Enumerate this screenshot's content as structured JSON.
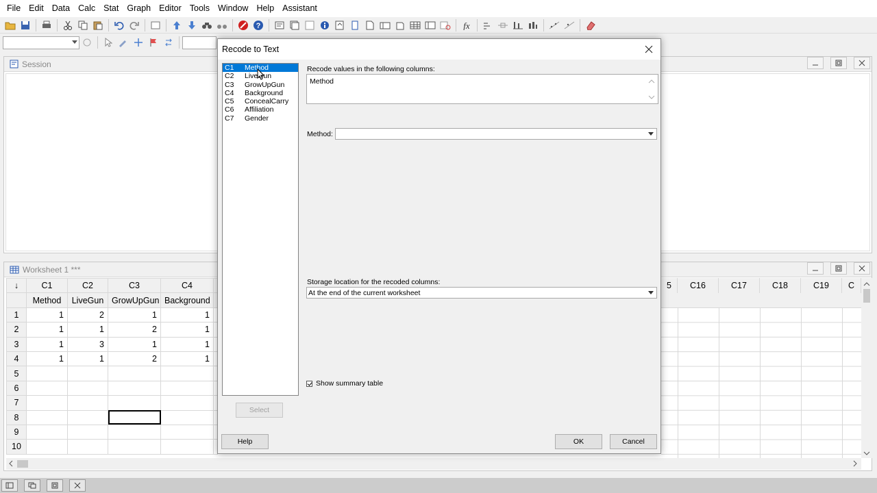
{
  "menubar": {
    "items": [
      "File",
      "Edit",
      "Data",
      "Calc",
      "Stat",
      "Graph",
      "Editor",
      "Tools",
      "Window",
      "Help",
      "Assistant"
    ]
  },
  "session": {
    "title": "Session"
  },
  "worksheet": {
    "title": "Worksheet 1 ***",
    "column_ids": [
      "C1",
      "C2",
      "C3",
      "C4"
    ],
    "column_names": [
      "Method",
      "LiveGun",
      "GrowUpGun",
      "Background"
    ],
    "right_column_ids": [
      "5",
      "C16",
      "C17",
      "C18",
      "C19",
      "C"
    ],
    "rows": [
      {
        "num": "1",
        "values": [
          "1",
          "2",
          "1",
          "1"
        ]
      },
      {
        "num": "2",
        "values": [
          "1",
          "1",
          "2",
          "1"
        ]
      },
      {
        "num": "3",
        "values": [
          "1",
          "3",
          "1",
          "1"
        ]
      },
      {
        "num": "4",
        "values": [
          "1",
          "1",
          "2",
          "1"
        ]
      },
      {
        "num": "5",
        "values": [
          "",
          "",
          "",
          ""
        ]
      },
      {
        "num": "6",
        "values": [
          "",
          "",
          "",
          ""
        ]
      },
      {
        "num": "7",
        "values": [
          "",
          "",
          "",
          ""
        ]
      },
      {
        "num": "8",
        "values": [
          "",
          "",
          "",
          ""
        ]
      },
      {
        "num": "9",
        "values": [
          "",
          "",
          "",
          ""
        ]
      },
      {
        "num": "10",
        "values": [
          "",
          "",
          "",
          ""
        ]
      }
    ]
  },
  "dialog": {
    "title": "Recode to Text",
    "variables": [
      {
        "col": "C1",
        "name": "Method"
      },
      {
        "col": "C2",
        "name": "LiveGun"
      },
      {
        "col": "C3",
        "name": "GrowUpGun"
      },
      {
        "col": "C4",
        "name": "Background"
      },
      {
        "col": "C5",
        "name": "ConcealCarry"
      },
      {
        "col": "C6",
        "name": "Affiliation"
      },
      {
        "col": "C7",
        "name": "Gender"
      }
    ],
    "recode_label": "Recode values in the following columns:",
    "recode_value": "Method",
    "method_label": "Method:",
    "method_value": "",
    "storage_label": "Storage location for the recoded columns:",
    "storage_value": "At the end of the current worksheet",
    "summary_checkbox": "Show summary table",
    "select_button": "Select",
    "help_button": "Help",
    "ok_button": "OK",
    "cancel_button": "Cancel"
  }
}
